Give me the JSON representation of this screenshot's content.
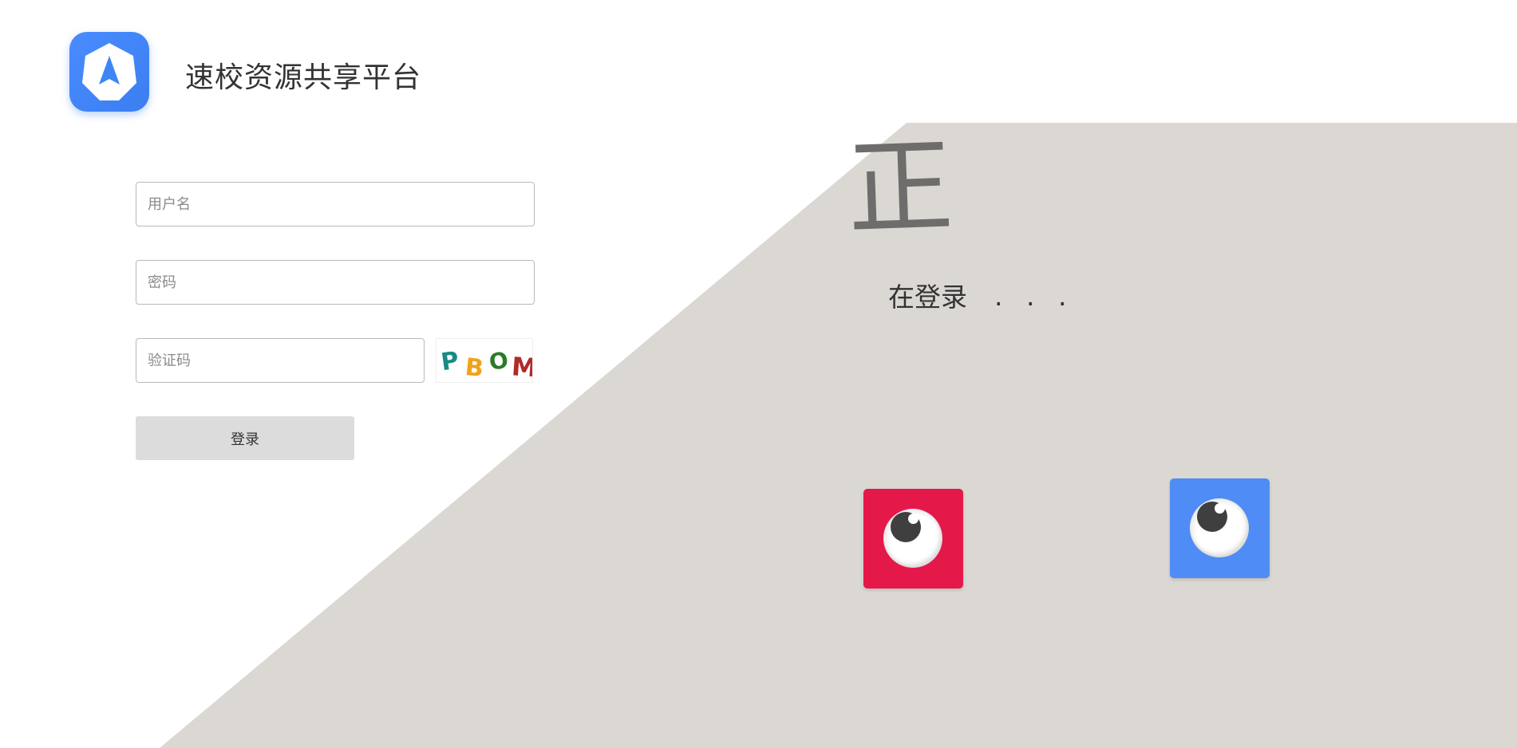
{
  "header": {
    "app_title": "速校资源共享平台",
    "logo_icon": "navigation-arrow-icon",
    "logo_color": "#4a8cff"
  },
  "form": {
    "username_placeholder": "用户名",
    "password_placeholder": "密码",
    "captcha_placeholder": "验证码",
    "captcha_image_text": "PBOM",
    "login_label": "登录"
  },
  "loading": {
    "big_char": "正",
    "text": "在登录",
    "dots": [
      ".",
      ".",
      "."
    ]
  },
  "colors": {
    "background_shape": "#dbd8d4",
    "red_box": "#e5184a",
    "blue_box": "#4f8cf5",
    "login_button": "#dcdcdc"
  }
}
